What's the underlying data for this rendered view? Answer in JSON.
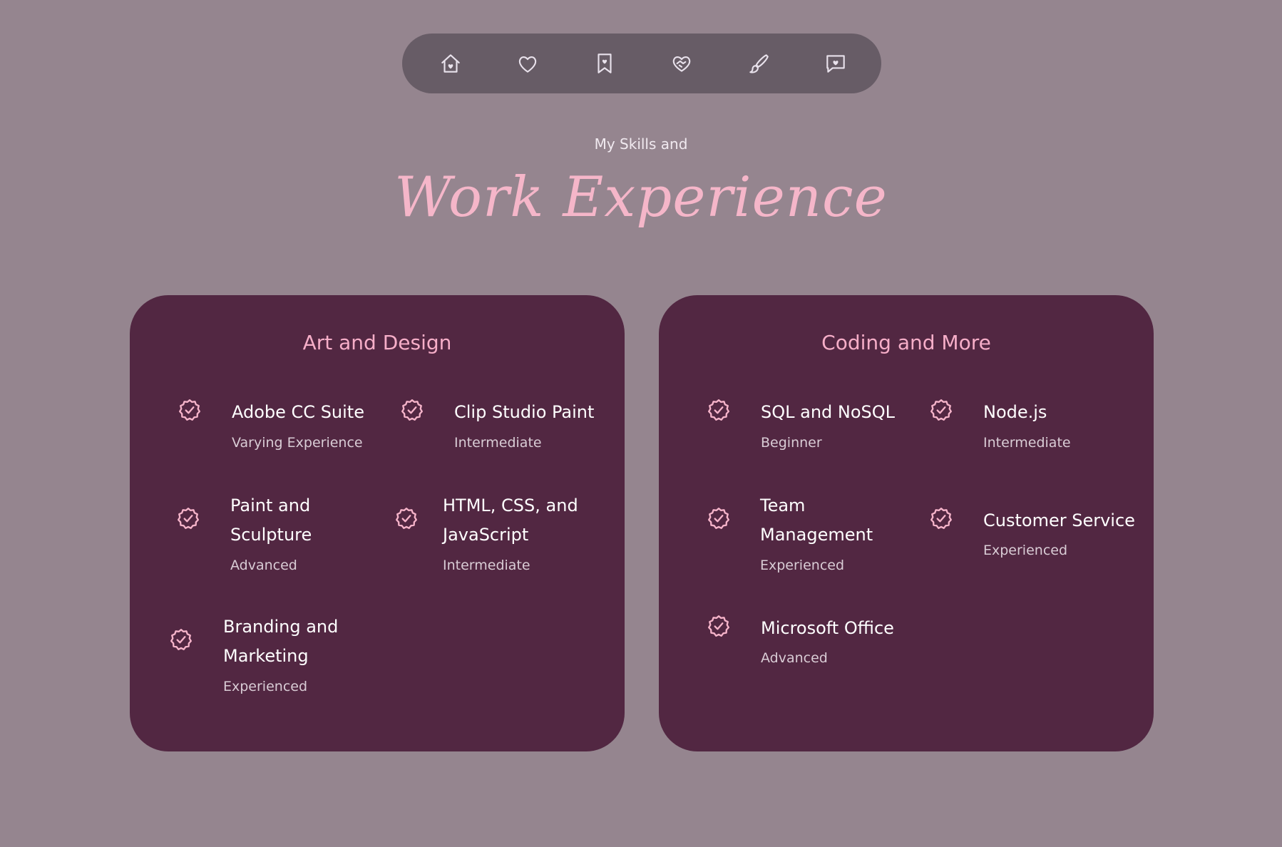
{
  "nav": {
    "items": [
      {
        "icon": "home-heart-icon"
      },
      {
        "icon": "heart-icon"
      },
      {
        "icon": "bookmark-heart-icon"
      },
      {
        "icon": "handshake-heart-icon"
      },
      {
        "icon": "brush-icon"
      },
      {
        "icon": "message-heart-icon"
      }
    ],
    "background": "#675c66"
  },
  "header": {
    "eyebrow": "My Skills and",
    "title": "Work Experience"
  },
  "colors": {
    "page_bg": "#95858f",
    "card_bg": "#522742",
    "accent_pink": "#f6aec8"
  },
  "cards": [
    {
      "title": "Art and Design",
      "skills": [
        {
          "name": "Adobe CC Suite",
          "level": "Varying Experience"
        },
        {
          "name": "Clip Studio Paint",
          "level": "Intermediate"
        },
        {
          "name_line1": "Paint and",
          "name_line2": "Sculpture",
          "level": "Advanced"
        },
        {
          "name_line1": "HTML, CSS, and",
          "name_line2": "JavaScript",
          "level": "Intermediate"
        },
        {
          "name_line1": "Branding and",
          "name_line2": "Marketing",
          "level": "Experienced"
        }
      ]
    },
    {
      "title": "Coding and More",
      "skills": [
        {
          "name": "SQL and NoSQL",
          "level": "Beginner"
        },
        {
          "name": "Node.js",
          "level": "Intermediate"
        },
        {
          "name_line1": "Team",
          "name_line2": "Management",
          "level": "Experienced"
        },
        {
          "name": "Customer Service",
          "level": "Experienced"
        },
        {
          "name": "Microsoft Office",
          "level": "Advanced"
        }
      ]
    }
  ]
}
